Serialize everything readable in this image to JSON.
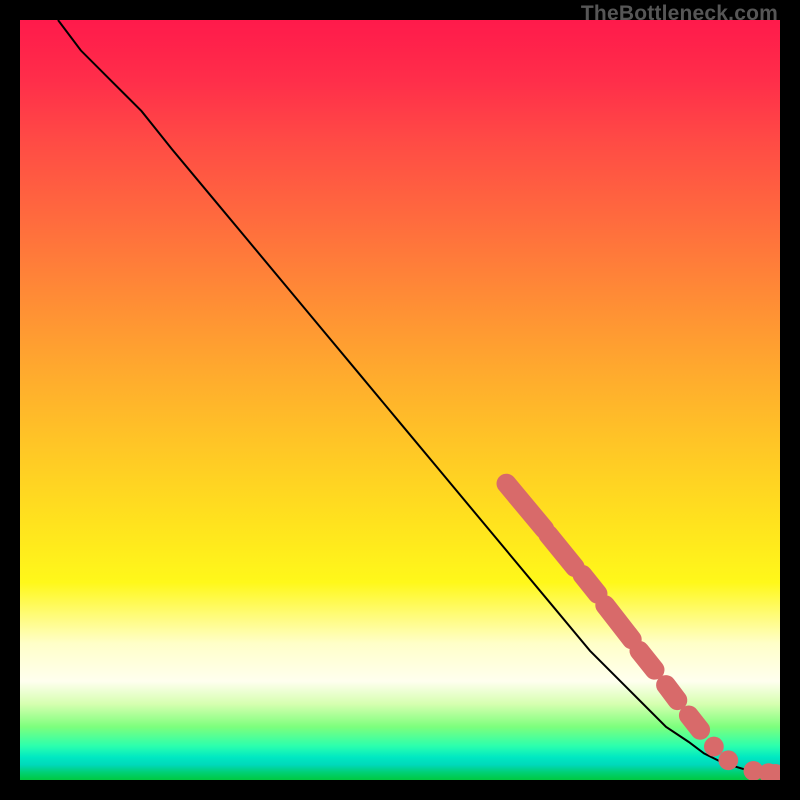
{
  "watermark": "TheBottleneck.com",
  "chart_data": {
    "type": "line",
    "title": "",
    "xlabel": "",
    "ylabel": "",
    "xlim": [
      0,
      100
    ],
    "ylim": [
      0,
      100
    ],
    "grid": false,
    "line": {
      "x": [
        5,
        8,
        12,
        16,
        20,
        25,
        30,
        35,
        40,
        45,
        50,
        55,
        60,
        65,
        70,
        75,
        80,
        85,
        88,
        90,
        92,
        94,
        96,
        98,
        100
      ],
      "y": [
        100,
        96,
        92,
        88,
        83,
        77,
        71,
        65,
        59,
        53,
        47,
        41,
        35,
        29,
        23,
        17,
        12,
        7,
        5,
        3.5,
        2.5,
        1.8,
        1.2,
        0.8,
        0.6
      ]
    },
    "markers": {
      "segments": [
        {
          "x0": 64,
          "y0": 39,
          "x1": 69,
          "y1": 33
        },
        {
          "x0": 69.5,
          "y0": 32.3,
          "x1": 73,
          "y1": 28
        },
        {
          "x0": 74,
          "y0": 27,
          "x1": 76,
          "y1": 24.5
        },
        {
          "x0": 77,
          "y0": 23,
          "x1": 80.5,
          "y1": 18.5
        },
        {
          "x0": 81.5,
          "y0": 17,
          "x1": 83.5,
          "y1": 14.5
        },
        {
          "x0": 85,
          "y0": 12.5,
          "x1": 86.5,
          "y1": 10.5
        },
        {
          "x0": 88,
          "y0": 8.5,
          "x1": 89.5,
          "y1": 6.6
        }
      ],
      "dots": [
        {
          "x": 91.3,
          "y": 4.4
        },
        {
          "x": 93.2,
          "y": 2.6
        },
        {
          "x": 96.5,
          "y": 1.2
        },
        {
          "x": 98.5,
          "y": 0.9
        },
        {
          "x": 99.4,
          "y": 0.8
        }
      ],
      "color": "#d86a6a",
      "radius_pct": 1.3
    }
  }
}
